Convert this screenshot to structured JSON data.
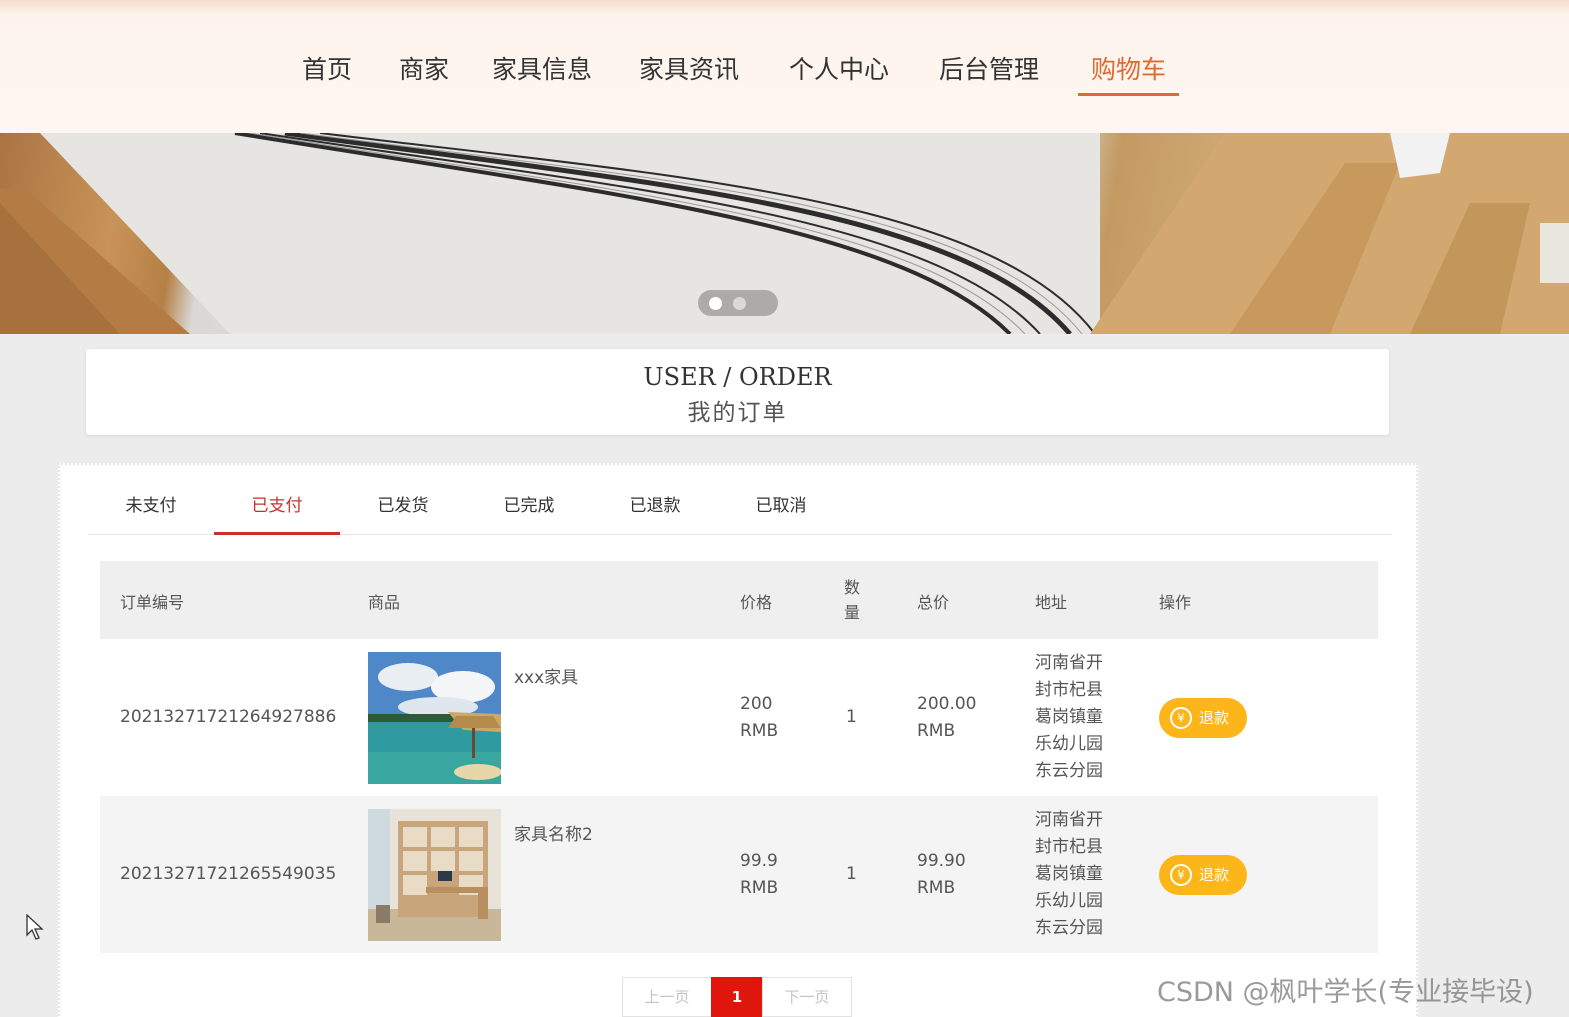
{
  "nav": {
    "items": [
      {
        "label": "首页"
      },
      {
        "label": "商家"
      },
      {
        "label": "家具信息"
      },
      {
        "label": "家具资讯"
      },
      {
        "label": "个人中心"
      },
      {
        "label": "后台管理"
      },
      {
        "label": "购物车",
        "active": true
      }
    ],
    "accent_color": "#e06a33"
  },
  "banner": {
    "slide_count": 2,
    "active_slide": 1
  },
  "heading": {
    "title_en": "USER / ORDER",
    "title_zh": "我的订单"
  },
  "order_tabs": {
    "items": [
      {
        "label": "未支付"
      },
      {
        "label": "已支付",
        "active": true
      },
      {
        "label": "已发货"
      },
      {
        "label": "已完成"
      },
      {
        "label": "已退款"
      },
      {
        "label": "已取消"
      }
    ],
    "active_color": "#c9302c"
  },
  "table": {
    "columns": {
      "order_no": "订单编号",
      "product": "商品",
      "price": "价格",
      "qty": "数量",
      "total": "总价",
      "address": "地址",
      "action": "操作"
    },
    "rows": [
      {
        "order_no": "20213271721264927886",
        "product_name": "xxx家具",
        "image_icon": "beach-hut-image",
        "price": "200",
        "price_unit": "RMB",
        "qty": "1",
        "total": "200.00",
        "total_unit": "RMB",
        "address": [
          "河南省开",
          "封市杞县",
          "葛岗镇童",
          "乐幼儿园",
          "东云分园"
        ],
        "action_label": "退款"
      },
      {
        "order_no": "20213271721265549035",
        "product_name": "家具名称2",
        "image_icon": "bookshelf-room-image",
        "price": "99.9",
        "price_unit": "RMB",
        "qty": "1",
        "total": "99.90",
        "total_unit": "RMB",
        "address": [
          "河南省开",
          "封市杞县",
          "葛岗镇童",
          "乐幼儿园",
          "东云分园"
        ],
        "action_label": "退款"
      }
    ],
    "action_icon": "yen-icon",
    "action_color": "#fdb61a"
  },
  "pagination": {
    "prev_label": "上一页",
    "current_page": "1",
    "next_label": "下一页",
    "current_color": "#e0150c"
  },
  "watermark": "CSDN @枫叶学长(专业接毕设)"
}
